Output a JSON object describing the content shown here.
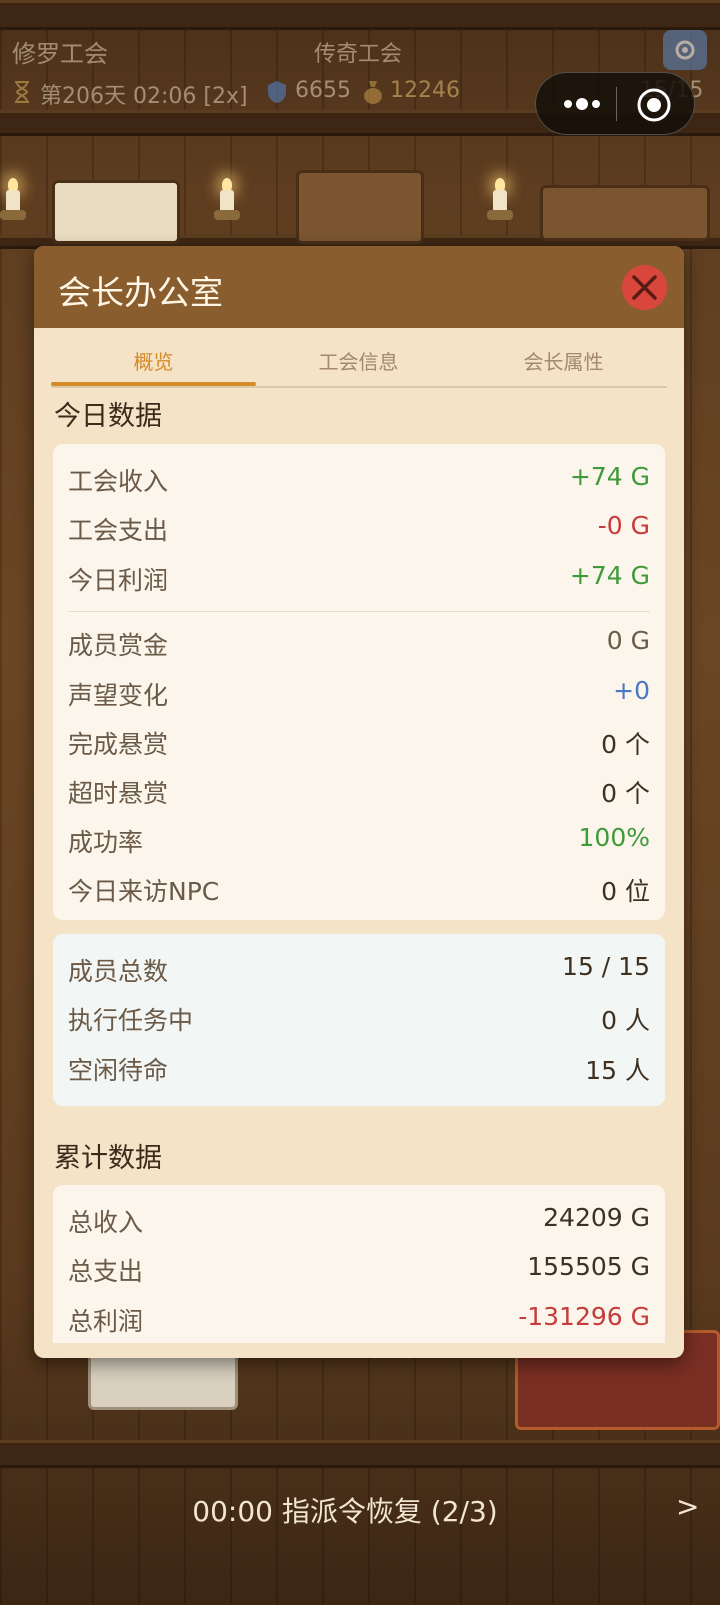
{
  "colors": {
    "modal_bg": "#f4e3c6",
    "header_bg": "#8a5d2f",
    "tab_active": "#d58b2a",
    "positive": "#3f9a3a",
    "negative": "#c73b3b",
    "neutral_blue": "#4a78c2",
    "close_button": "#d9473c"
  },
  "hud": {
    "guild_name": "修罗工会",
    "guild_rank": "传奇工会",
    "day": "第206天 02:06 [2x]",
    "reputation": "6655",
    "gold": "12246",
    "members": "15/15",
    "icons": [
      "hourglass-icon",
      "shield-icon",
      "money-bag-icon",
      "settings-icon",
      "more-icon",
      "target-icon"
    ]
  },
  "modal": {
    "title": "会长办公室",
    "close_icon": "close-icon",
    "tabs": [
      {
        "label": "概览",
        "active": true
      },
      {
        "label": "工会信息",
        "active": false
      },
      {
        "label": "会长属性",
        "active": false
      }
    ],
    "today_title": "今日数据",
    "today_finance": [
      {
        "label": "工会收入",
        "value": "+74 G",
        "color": "#3f9a3a"
      },
      {
        "label": "工会支出",
        "value": "-0 G",
        "color": "#c73b3b"
      },
      {
        "label": "今日利润",
        "value": "+74 G",
        "color": "#3f9a3a"
      }
    ],
    "today_stats": [
      {
        "label": "成员赏金",
        "value": "0 G",
        "color": "#6b5a48"
      },
      {
        "label": "声望变化",
        "value": "+0",
        "color": "#4a78c2"
      },
      {
        "label": "完成悬赏",
        "value": "0 个",
        "color": "#3f3122"
      },
      {
        "label": "超时悬赏",
        "value": "0 个",
        "color": "#3f3122"
      },
      {
        "label": "成功率",
        "value": "100%",
        "color": "#3f9a3a"
      },
      {
        "label": "今日来访NPC",
        "value": "0 位",
        "color": "#3f3122"
      }
    ],
    "member_stats": [
      {
        "label": "成员总数",
        "value": "15 / 15",
        "color": "#3f3122"
      },
      {
        "label": "执行任务中",
        "value": "0 人",
        "color": "#3f3122"
      },
      {
        "label": "空闲待命",
        "value": "15 人",
        "color": "#3f3122"
      }
    ],
    "total_title": "累计数据",
    "total_stats": [
      {
        "label": "总收入",
        "value": "24209 G",
        "color": "#3f3122"
      },
      {
        "label": "总支出",
        "value": "155505 G",
        "color": "#3f3122"
      },
      {
        "label": "总利润",
        "value": "-131296 G",
        "color": "#c73b3b"
      }
    ]
  },
  "bottom": {
    "recover_text": "00:00 指派令恢复 (2/3)",
    "next_label": ">"
  }
}
